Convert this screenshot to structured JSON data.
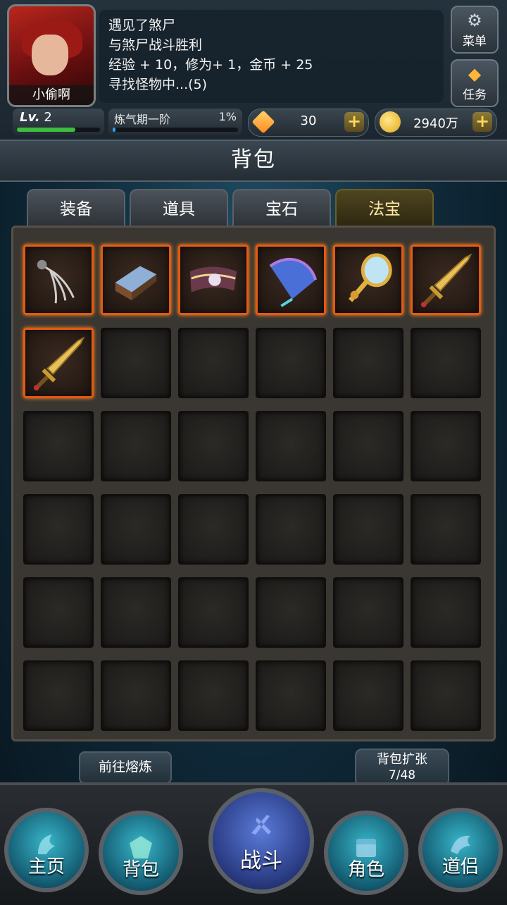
{
  "player": {
    "name": "小偷啊",
    "level_label": "Lv.",
    "level": "2",
    "level_progress": 0.7,
    "cultivation_stage": "炼气期一阶",
    "cultivation_percent": "1%"
  },
  "battle_log": [
    "遇见了煞尸",
    "与煞尸战斗胜利",
    "经验 + 10，修为+ 1，金币 + 25",
    "寻找怪物中...(5)"
  ],
  "corner_buttons": {
    "menu": "菜单",
    "task": "任务"
  },
  "currency": {
    "gems": "30",
    "gold": "2940万",
    "plus": "+"
  },
  "bag": {
    "title": "背包",
    "tabs": [
      "装备",
      "道具",
      "宝石",
      "法宝"
    ],
    "active_tab": "法宝",
    "items": [
      "whip-icon",
      "scroll-icon",
      "banner-icon",
      "fan-icon",
      "mirror-icon",
      "sword-icon",
      "sword-icon"
    ],
    "capacity": 48
  },
  "actions": {
    "smelt": "前往熔炼",
    "expand": "背包扩张",
    "count": "7/48"
  },
  "nav": [
    "主页",
    "背包",
    "战斗",
    "角色",
    "道侣"
  ],
  "colors": {
    "item_border": "#e25a14",
    "active_tab": "#4e4520",
    "accent_gold": "#ffd75a"
  }
}
